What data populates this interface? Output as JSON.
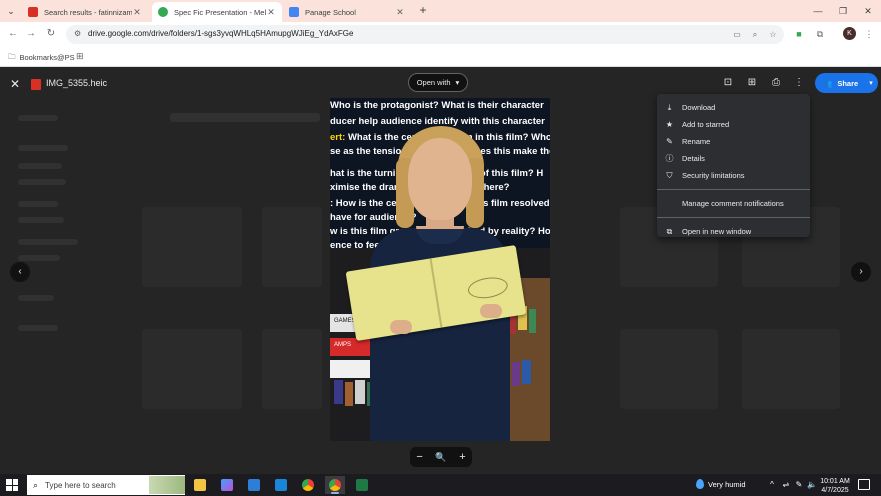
{
  "browser": {
    "tabs": [
      {
        "title": "Search results - fatinnizamudd",
        "favicon_color": "#d93025",
        "active": false
      },
      {
        "title": "Spec Fic Presentation - Mellia",
        "favicon_color": "#34a853",
        "active": true
      },
      {
        "title": "Panage School",
        "favicon_color": "#4285f4",
        "active": false
      }
    ],
    "url": "drive.google.com/drive/folders/1-sgs3yvqWHLq5HAmupgWJiEg_YdAxFGe",
    "bookmarks": [
      {
        "label": "Bookmarks@PS"
      }
    ],
    "profile_initial": "K"
  },
  "viewer": {
    "file_name": "IMG_5355.heic",
    "open_with_label": "Open with",
    "share_label": "Share",
    "accent": "#1a73e8",
    "photo_text": [
      {
        "lead": "",
        "text": "Who is the protagonist? What is their character"
      },
      {
        "lead": "",
        "text": "ducer help audience identify with this character"
      },
      {
        "lead": "ert:",
        "text": " What is the central problem in this film? Who"
      },
      {
        "lead": "",
        "text": "se as the tension builds? How does this make the"
      },
      {
        "lead": "",
        "text": "hat is the turning point or climax of this film? H"
      },
      {
        "lead": "",
        "text": "ximise the drama? What happens here?"
      },
      {
        "lead": "",
        "text": ": How is the central problem of this film resolved? W"
      },
      {
        "lead": "",
        "text": "have for audience?"
      },
      {
        "lead": "",
        "text": "w is this film grounded or inspired by reality? How"
      },
      {
        "lead": "",
        "text": "ence to feel about these issues?"
      }
    ],
    "photo_binder_labels": [
      "GAMES",
      "AMPS"
    ]
  },
  "context_menu": {
    "items": [
      {
        "label": "Download",
        "icon": "download-icon",
        "glyph": "⤓"
      },
      {
        "label": "Add to starred",
        "icon": "star-icon",
        "glyph": "★"
      },
      {
        "label": "Rename",
        "icon": "pencil-icon",
        "glyph": "✎"
      },
      {
        "label": "Details",
        "icon": "info-icon",
        "glyph": "ⓘ"
      },
      {
        "label": "Security limitations",
        "icon": "shield-icon",
        "glyph": "⛉"
      }
    ],
    "secondary": [
      {
        "label": "Manage comment notifications"
      }
    ],
    "tertiary": [
      {
        "label": "Open in new window",
        "icon": "open-new-window-icon",
        "glyph": "⧉"
      }
    ]
  },
  "taskbar": {
    "search_placeholder": "Type here to search",
    "weather": "Very humid",
    "time": "10:01 AM",
    "date": "4/7/2025"
  }
}
